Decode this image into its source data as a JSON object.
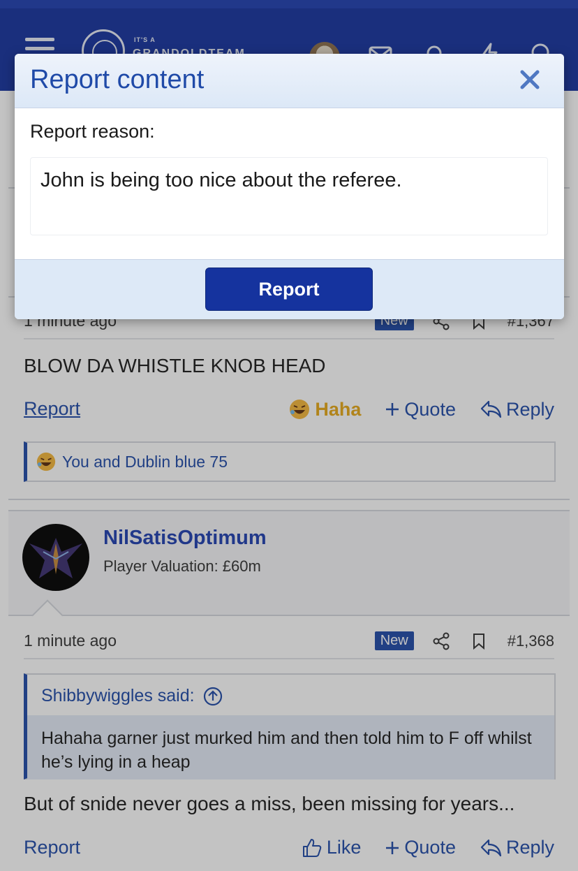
{
  "header": {
    "logo_small": "IT'S A",
    "logo_name": "GRANDOLDTEAM"
  },
  "post1": {
    "time": "1 minute ago",
    "badge": "New",
    "number": "#1,367",
    "text": "BLOW DA WHISTLE KNOB HEAD",
    "report_label": "Report",
    "haha_label": "Haha",
    "quote_label": "Quote",
    "reply_label": "Reply",
    "reactions_text": "You and Dublin blue 75"
  },
  "post2": {
    "username": "NilSatisOptimum",
    "user_title": "Player Valuation: £60m",
    "time": "1 minute ago",
    "badge": "New",
    "number": "#1,368",
    "quote_author": "Shibbywiggles said:",
    "quote_text": "Hahaha garner just murked him and then told him to F off whilst he’s lying in a heap",
    "text": "But of snide never goes a miss, been missing for years...",
    "report_label": "Report",
    "like_label": "Like",
    "quote_label": "Quote",
    "reply_label": "Reply"
  },
  "modal": {
    "title": "Report content",
    "reason_label": "Report reason:",
    "reason_value": "John is being too nice about the referee.",
    "submit_label": "Report"
  },
  "colors": {
    "brand": "#15339e",
    "link": "#1f4aa8",
    "haha": "#e6a817"
  }
}
